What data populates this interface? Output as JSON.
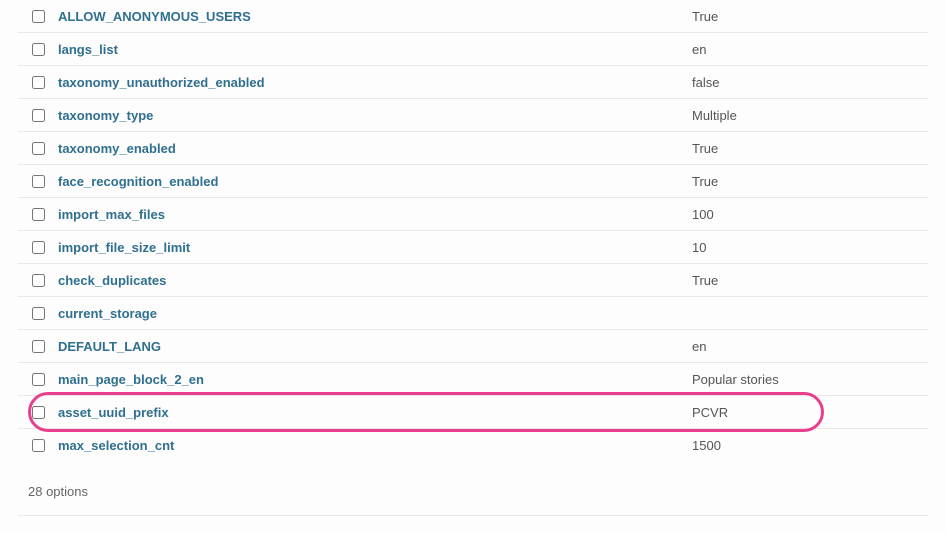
{
  "rows": [
    {
      "key": "ALLOW_ANONYMOUS_USERS",
      "value": "True",
      "highlighted": false
    },
    {
      "key": "langs_list",
      "value": "en",
      "highlighted": false
    },
    {
      "key": "taxonomy_unauthorized_enabled",
      "value": "false",
      "highlighted": false
    },
    {
      "key": "taxonomy_type",
      "value": "Multiple",
      "highlighted": false
    },
    {
      "key": "taxonomy_enabled",
      "value": "True",
      "highlighted": false
    },
    {
      "key": "face_recognition_enabled",
      "value": "True",
      "highlighted": false
    },
    {
      "key": "import_max_files",
      "value": "100",
      "highlighted": false
    },
    {
      "key": "import_file_size_limit",
      "value": "10",
      "highlighted": false
    },
    {
      "key": "check_duplicates",
      "value": "True",
      "highlighted": false
    },
    {
      "key": "current_storage",
      "value": "",
      "highlighted": false
    },
    {
      "key": "DEFAULT_LANG",
      "value": "en",
      "highlighted": false
    },
    {
      "key": "main_page_block_2_en",
      "value": "Popular stories",
      "highlighted": false
    },
    {
      "key": "asset_uuid_prefix",
      "value": "PCVR",
      "highlighted": true
    },
    {
      "key": "max_selection_cnt",
      "value": "1500",
      "highlighted": false
    }
  ],
  "footer": {
    "count_label": "28 options"
  }
}
